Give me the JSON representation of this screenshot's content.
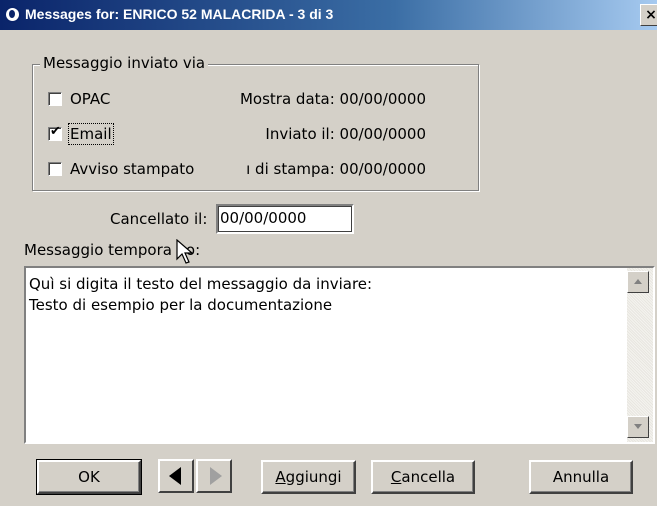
{
  "window": {
    "title": "Messages for: ENRICO 52 MALACRIDA - 3 di 3",
    "close_glyph": "×",
    "icon": "app-icon"
  },
  "group": {
    "legend": "Messaggio inviato via",
    "items": [
      {
        "label": "OPAC",
        "checked": false,
        "check_glyph": "",
        "date_label": "Mostra data: 00/00/0000"
      },
      {
        "label": "Email",
        "checked": true,
        "check_glyph": "✔",
        "date_label": "Inviato il: 00/00/0000"
      },
      {
        "label": "Avviso stampato",
        "checked": false,
        "check_glyph": "",
        "date_label": "ı di stampa: 00/00/0000"
      }
    ]
  },
  "cancelled": {
    "label": "Cancellato il:",
    "value": "00/00/0000"
  },
  "message": {
    "label": "Messaggio tempora  eo:",
    "lines": [
      "Quì si digita il testo del messaggio da inviare:",
      "Testo di esempio per la documentazione"
    ]
  },
  "buttons": {
    "ok": "OK",
    "prev_icon": "arrow-left-icon",
    "next_icon": "arrow-right-icon",
    "add_prefix": "A",
    "add_rest": "ggiungi",
    "delete_prefix": "C",
    "delete_rest": "ancella",
    "cancel": "Annulla"
  },
  "colors": {
    "title_start": "#0a246a",
    "title_end": "#a6caf0",
    "dialog_bg": "#d4d0c8"
  }
}
